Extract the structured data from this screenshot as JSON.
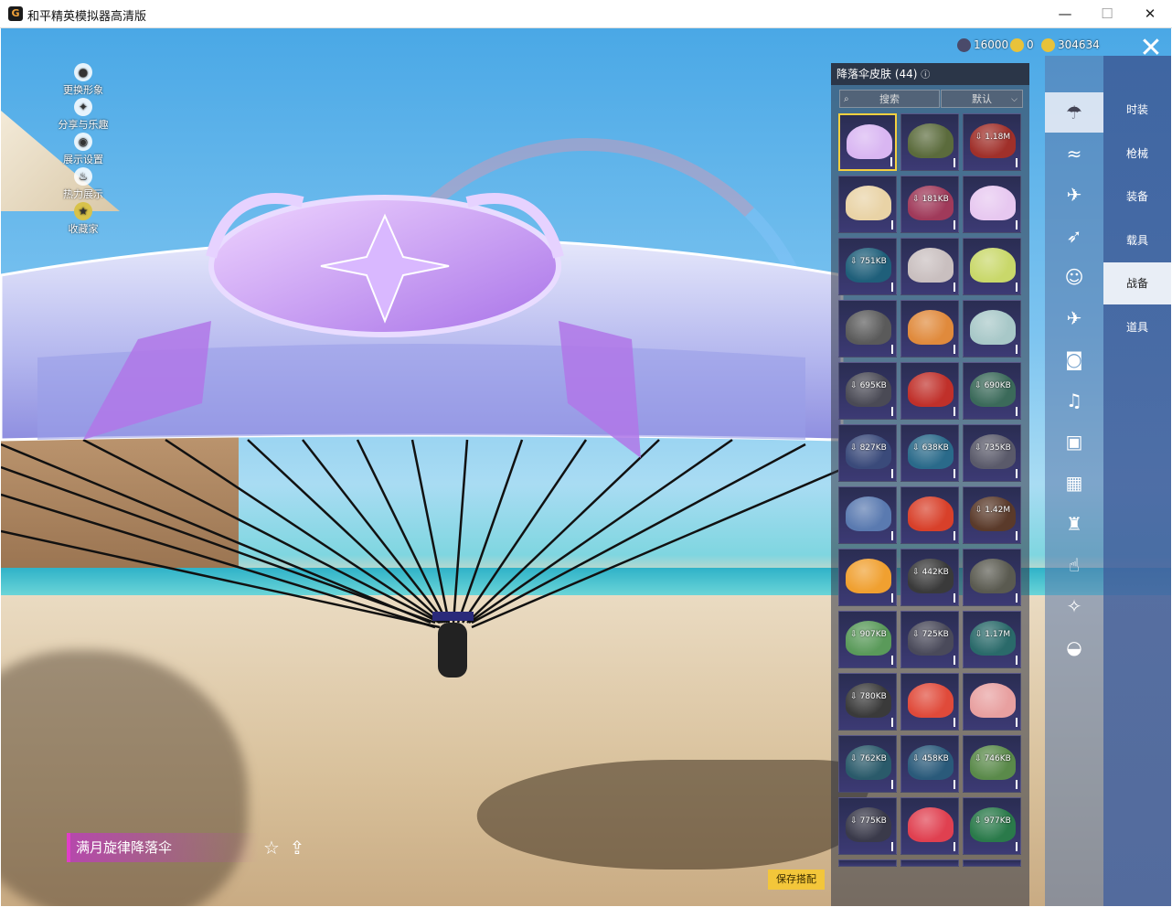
{
  "window": {
    "title": "和平精英模拟器高清版",
    "minimize": "—",
    "maximize": "☐",
    "close": "✕"
  },
  "left_tools": [
    {
      "label": "更换形象",
      "icon": "person-icon"
    },
    {
      "label": "分享与乐趣",
      "icon": "share-fun-icon"
    },
    {
      "label": "展示设置",
      "icon": "eye-icon"
    },
    {
      "label": "热力展示",
      "icon": "flame-icon"
    },
    {
      "label": "收藏家",
      "icon": "collector-badge-icon"
    }
  ],
  "currency": [
    {
      "value": "16000",
      "color": "#4a4a6a"
    },
    {
      "value": "0",
      "color": "#e8c23a"
    },
    {
      "value": "304634",
      "color": "#e8c23a"
    }
  ],
  "categories": [
    "时装",
    "枪械",
    "装备",
    "载具",
    "战备",
    "道具"
  ],
  "active_category": "战备",
  "sub_icons": [
    "parachute-icon",
    "glider-icon",
    "plane-icon",
    "dive-icon",
    "emote-icon",
    "trail-icon",
    "backpack-pet-icon",
    "sound-icon",
    "pendant-icon",
    "photo-icon",
    "extinguisher-icon",
    "tap-icon",
    "wand-icon",
    "ufo-icon"
  ],
  "panel": {
    "title": "降落伞皮肤 (44)",
    "help": "ⓘ",
    "search_label": "搜索",
    "sort_label": "默认"
  },
  "skins": [
    {
      "size": "",
      "color": "#d9b6f2",
      "selected": true
    },
    {
      "size": "",
      "color": "#5b6b3c"
    },
    {
      "size": "1.18M",
      "color": "#a0302a"
    },
    {
      "size": "",
      "color": "#e9d3a6"
    },
    {
      "size": "181KB",
      "color": "#a03a5a"
    },
    {
      "size": "",
      "color": "#e7c8f0"
    },
    {
      "size": "751KB",
      "color": "#1f5f7a"
    },
    {
      "size": "",
      "color": "#c9bfbf"
    },
    {
      "size": "",
      "color": "#c9d86a"
    },
    {
      "size": "",
      "color": "#5a5a5a"
    },
    {
      "size": "",
      "color": "#e08a3c"
    },
    {
      "size": "",
      "color": "#a8c8c8"
    },
    {
      "size": "695KB",
      "color": "#4a4a55"
    },
    {
      "size": "",
      "color": "#c0302a"
    },
    {
      "size": "690KB",
      "color": "#3b6a5a"
    },
    {
      "size": "827KB",
      "color": "#3a4a7a"
    },
    {
      "size": "638KB",
      "color": "#2a6a8a"
    },
    {
      "size": "735KB",
      "color": "#5a5a6a"
    },
    {
      "size": "",
      "color": "#5a7ab0"
    },
    {
      "size": "",
      "color": "#d8402a"
    },
    {
      "size": "1.42M",
      "color": "#5a3a2a"
    },
    {
      "size": "",
      "color": "#f0a030"
    },
    {
      "size": "442KB",
      "color": "#3a3a3a"
    },
    {
      "size": "",
      "color": "#5a5a50"
    },
    {
      "size": "907KB",
      "color": "#5a9a5a"
    },
    {
      "size": "725KB",
      "color": "#4a4a5a"
    },
    {
      "size": "1.17M",
      "color": "#2a6a6a"
    },
    {
      "size": "780KB",
      "color": "#3a3a3a"
    },
    {
      "size": "",
      "color": "#e04a3a"
    },
    {
      "size": "",
      "color": "#e8a0a0"
    },
    {
      "size": "762KB",
      "color": "#2a5a6a"
    },
    {
      "size": "458KB",
      "color": "#2a5a7a"
    },
    {
      "size": "746KB",
      "color": "#5a8a4a"
    },
    {
      "size": "775KB",
      "color": "#3a3a4a"
    },
    {
      "size": "",
      "color": "#e04050"
    },
    {
      "size": "977KB",
      "color": "#2a7a4a"
    },
    {
      "size": "",
      "color": "#3a3a4a"
    },
    {
      "size": "",
      "color": "#3a3a4a"
    },
    {
      "size": "",
      "color": "#3a3a4a"
    }
  ],
  "item_name": "满月旋律降落伞",
  "save_button": "保存搭配",
  "close_label": "✕"
}
